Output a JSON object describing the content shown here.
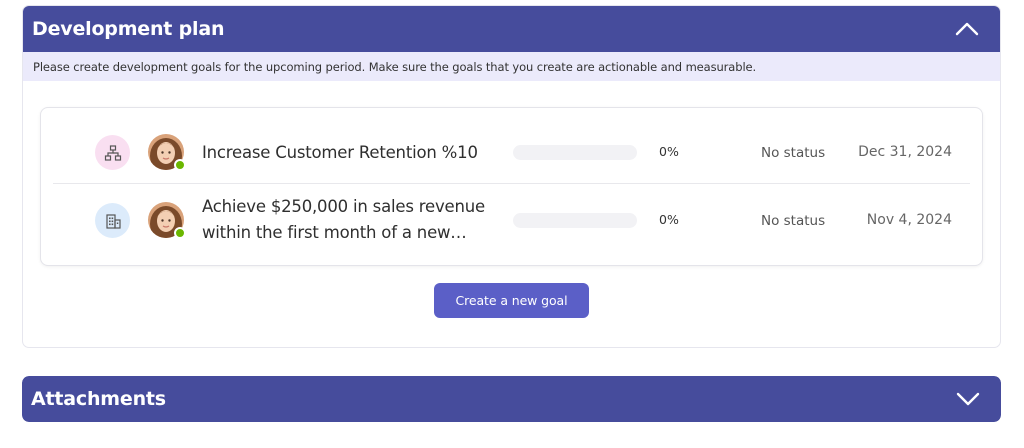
{
  "plan": {
    "title": "Development plan",
    "info": "Please create development goals for the upcoming period. Make sure the goals that you create are actionable and measurable.",
    "goals": [
      {
        "type_icon": "org-chart-icon",
        "title": "Increase Customer Retention %10",
        "progress": 0,
        "progress_label": "0%",
        "status": "No status",
        "due": "Dec 31, 2024"
      },
      {
        "type_icon": "building-icon",
        "title": "Achieve $250,000 in sales revenue within the first month of a new…",
        "progress": 0,
        "progress_label": "0%",
        "status": "No status",
        "due": "Nov 4, 2024"
      }
    ],
    "create_button": "Create a new goal"
  },
  "attachments": {
    "title": "Attachments"
  },
  "colors": {
    "header": "#464c9c",
    "info_bar": "#ebeafb",
    "accent": "#5b5fc7",
    "presence": "#6bb700"
  }
}
